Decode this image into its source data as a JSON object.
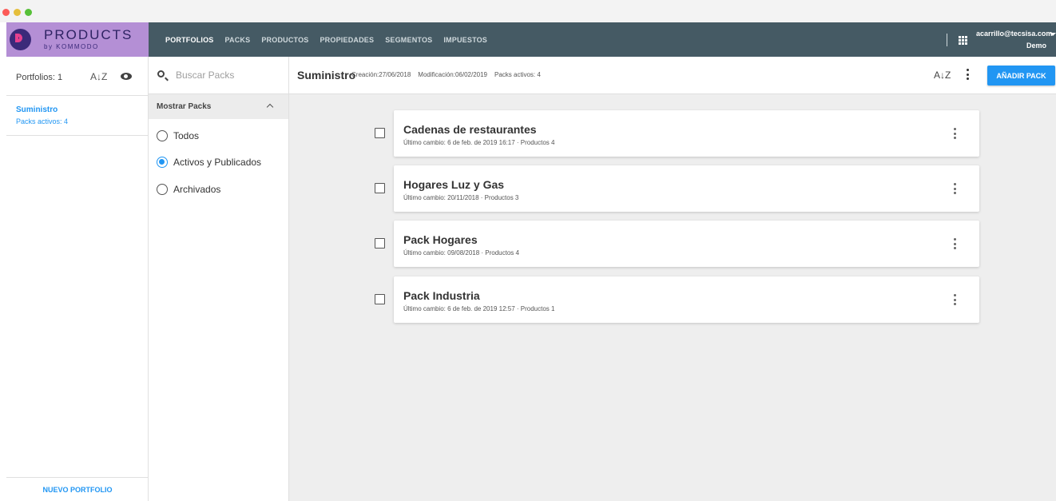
{
  "brand": {
    "name": "PRODUCTS",
    "sub": "by KOMMODO"
  },
  "nav": [
    {
      "label": "PORTFOLIOS",
      "active": true
    },
    {
      "label": "PACKS",
      "active": false
    },
    {
      "label": "PRODUCTOS",
      "active": false
    },
    {
      "label": "PROPIEDADES",
      "active": false
    },
    {
      "label": "SEGMENTOS",
      "active": false
    },
    {
      "label": "IMPUESTOS",
      "active": false
    }
  ],
  "user": {
    "email": "acarrillo@tecsisa.com",
    "org": "Demo"
  },
  "portfolios": {
    "count_label": "Portfolios: 1",
    "sort_label": "A↓Z",
    "items": [
      {
        "name": "Suministro",
        "subtitle": "Packs activos: 4"
      }
    ],
    "new_button": "NUEVO PORTFOLIO"
  },
  "filter": {
    "search_placeholder": "Buscar Packs",
    "section_label": "Mostrar Packs",
    "options": [
      {
        "label": "Todos",
        "selected": false
      },
      {
        "label": "Activos y Publicados",
        "selected": true
      },
      {
        "label": "Archivados",
        "selected": false
      }
    ]
  },
  "main": {
    "title": "Suministro",
    "creation": "Creación:27/06/2018",
    "modification": "Modificación:06/02/2019",
    "active_packs": "Packs activos: 4",
    "sort_label": "A↓Z",
    "add_button": "AÑADIR PACK"
  },
  "packs": [
    {
      "name": "Cadenas de restaurantes",
      "meta": "Último cambio: 6 de feb. de 2019 16:17 · Productos 4"
    },
    {
      "name": "Hogares Luz y Gas",
      "meta": "Último cambio: 20/11/2018 · Productos 3"
    },
    {
      "name": "Pack Hogares",
      "meta": "Último cambio: 09/08/2018 · Productos 4"
    },
    {
      "name": "Pack Industria",
      "meta": "Último cambio: 6 de feb. de 2019 12:57 · Productos 1"
    }
  ],
  "colors": {
    "accent": "#2196f3",
    "topbar": "#455a64",
    "brand": "#b48fd5",
    "content_bg": "#eeeeee"
  }
}
